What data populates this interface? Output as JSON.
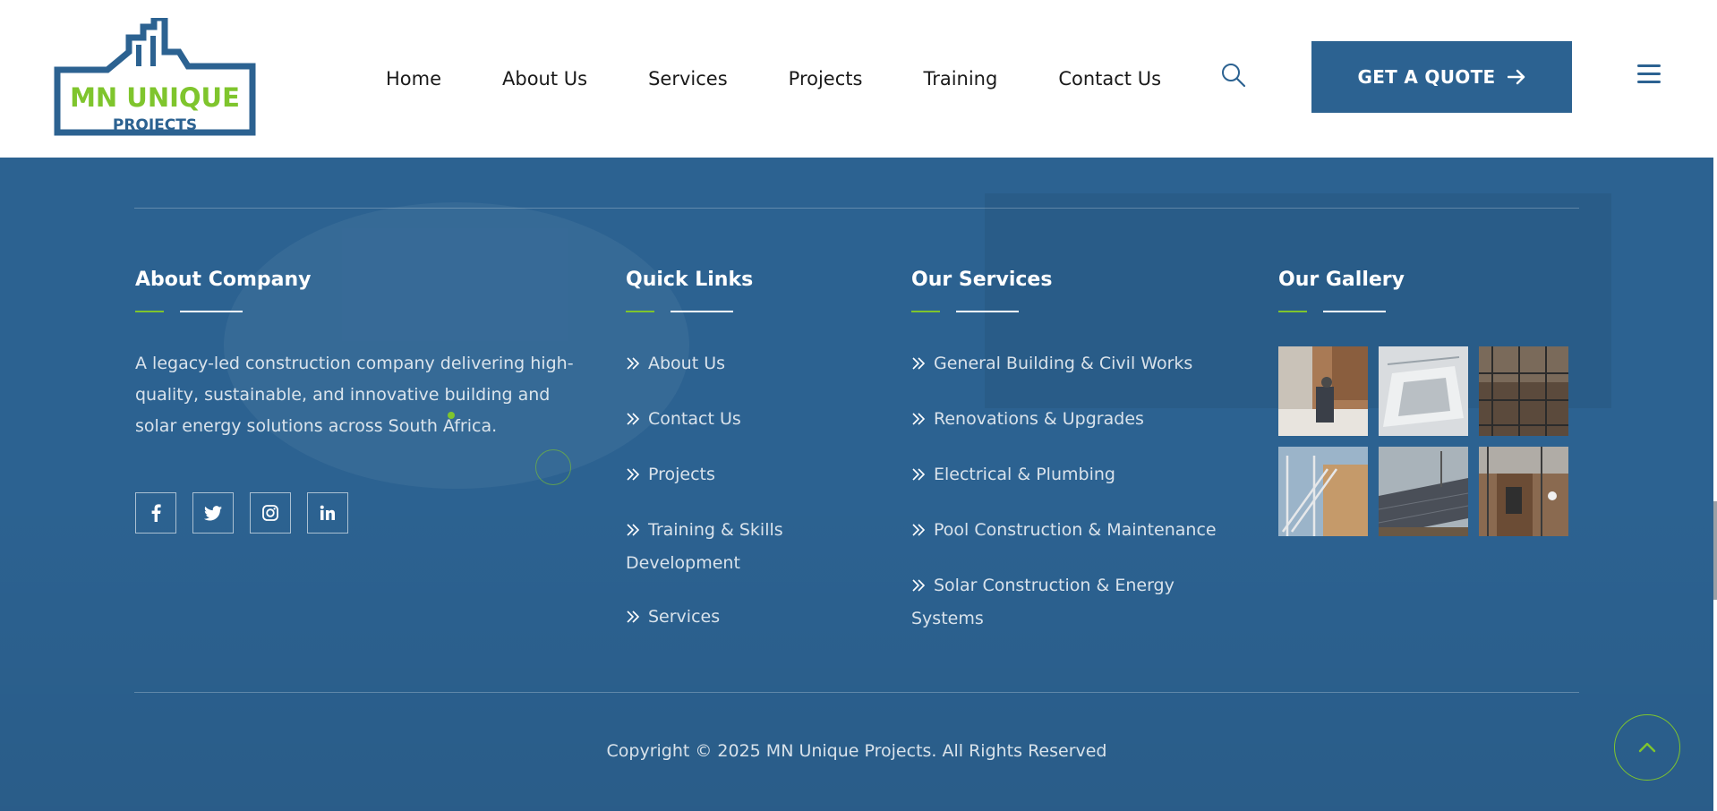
{
  "header": {
    "logo": {
      "line1": "MN UNIQUE",
      "line2": "PROJECTS",
      "icon": "building-outline-logo",
      "brand_blue": "#2c6291",
      "brand_green": "#7fc52d"
    },
    "nav": [
      {
        "label": "Home"
      },
      {
        "label": "About Us"
      },
      {
        "label": "Services"
      },
      {
        "label": "Projects"
      },
      {
        "label": "Training"
      },
      {
        "label": "Contact Us"
      }
    ],
    "search_icon": "search-icon",
    "quote_button": {
      "label": "GET A QUOTE",
      "icon": "arrow-right-icon"
    },
    "menu_icon": "hamburger-menu-icon"
  },
  "footer": {
    "about": {
      "title": "About Company",
      "text": "A legacy-led construction company delivering high-quality, sustainable, and innovative building and solar energy solutions across South Africa.",
      "socials": [
        {
          "icon": "facebook-icon"
        },
        {
          "icon": "twitter-icon"
        },
        {
          "icon": "instagram-icon"
        },
        {
          "icon": "linkedin-icon"
        }
      ]
    },
    "quick_links": {
      "title": "Quick Links",
      "items": [
        {
          "label": "About Us"
        },
        {
          "label": "Contact Us"
        },
        {
          "label": "Projects"
        },
        {
          "label": "Training & Skills Development"
        },
        {
          "label": "Services"
        }
      ]
    },
    "services": {
      "title": "Our Services",
      "items": [
        {
          "label": "General Building & Civil Works"
        },
        {
          "label": "Renovations & Upgrades"
        },
        {
          "label": "Electrical & Plumbing"
        },
        {
          "label": "Pool Construction & Maintenance"
        },
        {
          "label": "Solar Construction & Energy Systems"
        }
      ]
    },
    "gallery": {
      "title": "Our Gallery",
      "images": [
        {
          "subject": "interior construction site"
        },
        {
          "subject": "concrete pool structure"
        },
        {
          "subject": "scaffolding on brick wall"
        },
        {
          "subject": "steel staircase scaffolding"
        },
        {
          "subject": "solar panel installation"
        },
        {
          "subject": "brick building under construction"
        }
      ]
    },
    "copyright": "Copyright © 2025 MN Unique Projects. All Rights Reserved",
    "back_to_top_icon": "chevron-up-icon"
  },
  "colors": {
    "footer_bg": "#2c6291",
    "accent_green": "#7fc52d",
    "button_bg": "#2c6291"
  }
}
